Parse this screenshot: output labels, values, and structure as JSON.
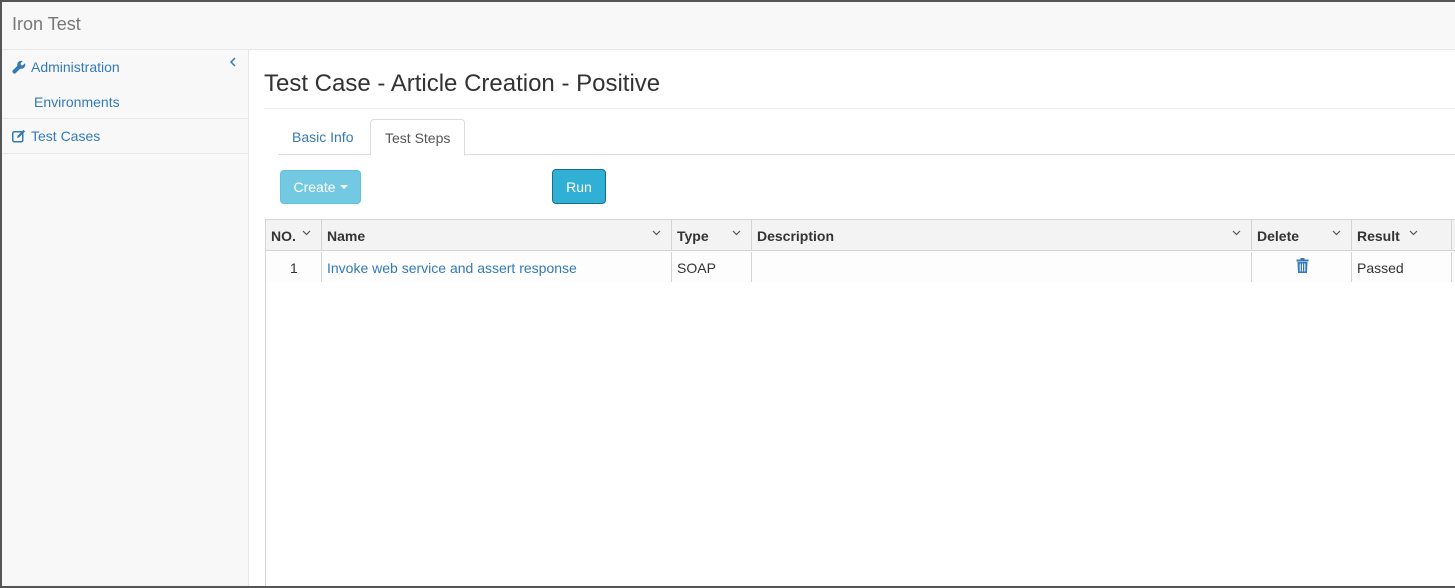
{
  "app": {
    "title": "Iron Test"
  },
  "sidebar": {
    "items": [
      {
        "label": "Administration",
        "icon": "wrench-icon",
        "sub_items": [
          {
            "label": "Environments"
          }
        ]
      },
      {
        "label": "Test Cases",
        "icon": "edit-icon"
      }
    ]
  },
  "page": {
    "title": "Test Case - Article Creation - Positive"
  },
  "tabs": [
    {
      "label": "Basic Info",
      "active": false
    },
    {
      "label": "Test Steps",
      "active": true
    }
  ],
  "toolbar": {
    "create_label": "Create",
    "run_label": "Run"
  },
  "grid": {
    "columns": [
      "NO.",
      "Name",
      "Type",
      "Description",
      "Delete",
      "Result"
    ],
    "rows": [
      {
        "no": "1",
        "name": "Invoke web service and assert response",
        "type": "SOAP",
        "description": "",
        "result": "Passed"
      }
    ]
  },
  "colors": {
    "link": "#337ab7",
    "button_info": "#5bc0de",
    "button_info_active": "#31b0d5"
  }
}
